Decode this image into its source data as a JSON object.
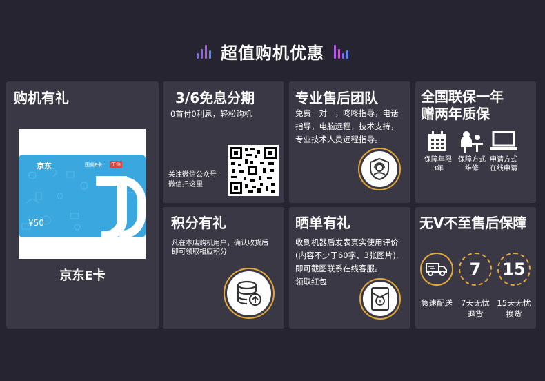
{
  "header": {
    "title": "超值购机优惠"
  },
  "gift_card": {
    "title": "购机有礼",
    "caption": "京东E卡",
    "card_brand": "京东",
    "card_partner": "国美E卡",
    "card_tag": "生活",
    "card_letters": "JD",
    "card_value": "¥50"
  },
  "installment": {
    "title": "3/6免息分期",
    "desc": "0首付0利息，轻松购机",
    "qr_line1": "关注微信公众号",
    "qr_line2": "微信扫这里"
  },
  "after_sales": {
    "title": "专业售后团队",
    "desc_line1": "免费一对一，咚咚指导，电话",
    "desc_line2": "指导，电脑远程，技术支持，",
    "desc_line3": "专业技术人员远程指导。"
  },
  "warranty": {
    "title_line1": "全国联保一年",
    "title_line2": "赠两年质保",
    "items": [
      {
        "icon": "calendar-icon",
        "line1": "保障年限",
        "line2": "3年"
      },
      {
        "icon": "service-person-icon",
        "line1": "保障方式",
        "line2": "维修"
      },
      {
        "icon": "laptop-icon",
        "line1": "申请方式",
        "line2": "在线申请"
      }
    ]
  },
  "points": {
    "title": "积分有礼",
    "desc_line1": "凡在本店购机用户，确认收货后",
    "desc_line2": "即可领取相应积分"
  },
  "review": {
    "title": "晒单有礼",
    "desc_line1": "收到机器后发表真实使用评价",
    "desc_line2": "(内容不少于60字、3张图片),",
    "desc_line3": "即可截图联系在线客服。",
    "desc_line4": "领取红包"
  },
  "guarantee": {
    "title": "无V不至售后保障",
    "items": [
      {
        "icon": "truck-icon",
        "number": "",
        "line1": "急速配送",
        "line2": ""
      },
      {
        "icon": "seven-day-icon",
        "number": "7",
        "line1": "7天无忧",
        "line2": "退货"
      },
      {
        "icon": "fifteen-day-icon",
        "number": "15",
        "line1": "15天无忧",
        "line2": "换货"
      }
    ]
  },
  "colors": {
    "background": "#262430",
    "card": "#3a3844",
    "accent_gold": "#e2a93a",
    "card_blue": "#3aa8de"
  }
}
